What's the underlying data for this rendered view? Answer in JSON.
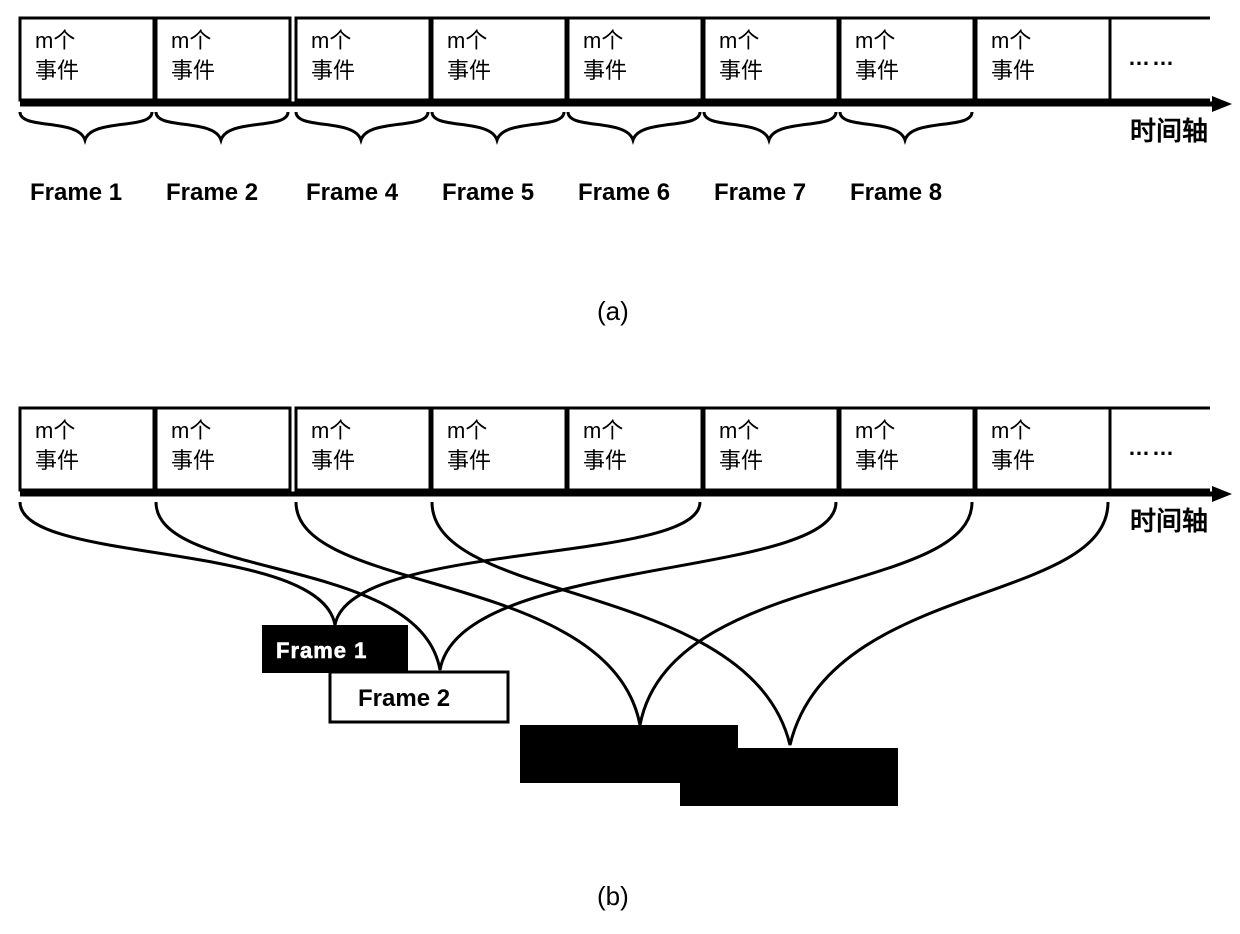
{
  "box_label": {
    "line1": "m个",
    "line2": "事件"
  },
  "ellipsis": "……",
  "axis_label": "时间轴",
  "panel_a_label": "(a)",
  "panel_b_label": "(b)",
  "frames_a": [
    "Frame 1",
    "Frame 2",
    "Frame 4",
    "Frame 5",
    "Frame 6",
    "Frame 7",
    "Frame 8"
  ],
  "frame1_box": "Frame 1",
  "frame2_box": "Frame 2"
}
